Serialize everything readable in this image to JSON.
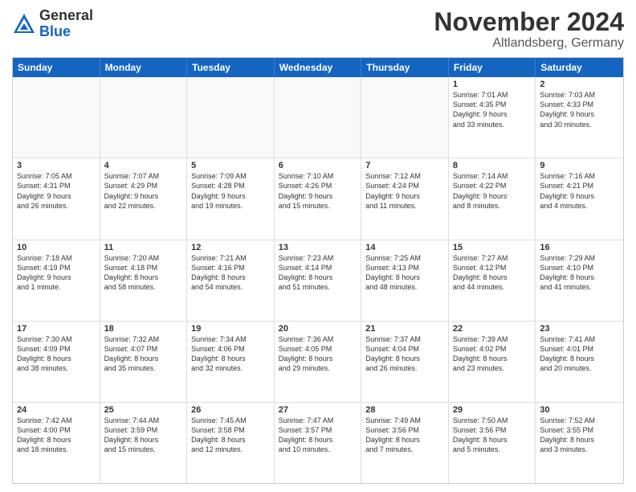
{
  "header": {
    "logo_general": "General",
    "logo_blue": "Blue",
    "month_title": "November 2024",
    "location": "Altlandsberg, Germany"
  },
  "days_of_week": [
    "Sunday",
    "Monday",
    "Tuesday",
    "Wednesday",
    "Thursday",
    "Friday",
    "Saturday"
  ],
  "rows": [
    [
      {
        "day": "",
        "info": ""
      },
      {
        "day": "",
        "info": ""
      },
      {
        "day": "",
        "info": ""
      },
      {
        "day": "",
        "info": ""
      },
      {
        "day": "",
        "info": ""
      },
      {
        "day": "1",
        "info": "Sunrise: 7:01 AM\nSunset: 4:35 PM\nDaylight: 9 hours\nand 33 minutes."
      },
      {
        "day": "2",
        "info": "Sunrise: 7:03 AM\nSunset: 4:33 PM\nDaylight: 9 hours\nand 30 minutes."
      }
    ],
    [
      {
        "day": "3",
        "info": "Sunrise: 7:05 AM\nSunset: 4:31 PM\nDaylight: 9 hours\nand 26 minutes."
      },
      {
        "day": "4",
        "info": "Sunrise: 7:07 AM\nSunset: 4:29 PM\nDaylight: 9 hours\nand 22 minutes."
      },
      {
        "day": "5",
        "info": "Sunrise: 7:09 AM\nSunset: 4:28 PM\nDaylight: 9 hours\nand 19 minutes."
      },
      {
        "day": "6",
        "info": "Sunrise: 7:10 AM\nSunset: 4:26 PM\nDaylight: 9 hours\nand 15 minutes."
      },
      {
        "day": "7",
        "info": "Sunrise: 7:12 AM\nSunset: 4:24 PM\nDaylight: 9 hours\nand 11 minutes."
      },
      {
        "day": "8",
        "info": "Sunrise: 7:14 AM\nSunset: 4:22 PM\nDaylight: 9 hours\nand 8 minutes."
      },
      {
        "day": "9",
        "info": "Sunrise: 7:16 AM\nSunset: 4:21 PM\nDaylight: 9 hours\nand 4 minutes."
      }
    ],
    [
      {
        "day": "10",
        "info": "Sunrise: 7:18 AM\nSunset: 4:19 PM\nDaylight: 9 hours\nand 1 minute."
      },
      {
        "day": "11",
        "info": "Sunrise: 7:20 AM\nSunset: 4:18 PM\nDaylight: 8 hours\nand 58 minutes."
      },
      {
        "day": "12",
        "info": "Sunrise: 7:21 AM\nSunset: 4:16 PM\nDaylight: 8 hours\nand 54 minutes."
      },
      {
        "day": "13",
        "info": "Sunrise: 7:23 AM\nSunset: 4:14 PM\nDaylight: 8 hours\nand 51 minutes."
      },
      {
        "day": "14",
        "info": "Sunrise: 7:25 AM\nSunset: 4:13 PM\nDaylight: 8 hours\nand 48 minutes."
      },
      {
        "day": "15",
        "info": "Sunrise: 7:27 AM\nSunset: 4:12 PM\nDaylight: 8 hours\nand 44 minutes."
      },
      {
        "day": "16",
        "info": "Sunrise: 7:29 AM\nSunset: 4:10 PM\nDaylight: 8 hours\nand 41 minutes."
      }
    ],
    [
      {
        "day": "17",
        "info": "Sunrise: 7:30 AM\nSunset: 4:09 PM\nDaylight: 8 hours\nand 38 minutes."
      },
      {
        "day": "18",
        "info": "Sunrise: 7:32 AM\nSunset: 4:07 PM\nDaylight: 8 hours\nand 35 minutes."
      },
      {
        "day": "19",
        "info": "Sunrise: 7:34 AM\nSunset: 4:06 PM\nDaylight: 8 hours\nand 32 minutes."
      },
      {
        "day": "20",
        "info": "Sunrise: 7:36 AM\nSunset: 4:05 PM\nDaylight: 8 hours\nand 29 minutes."
      },
      {
        "day": "21",
        "info": "Sunrise: 7:37 AM\nSunset: 4:04 PM\nDaylight: 8 hours\nand 26 minutes."
      },
      {
        "day": "22",
        "info": "Sunrise: 7:39 AM\nSunset: 4:02 PM\nDaylight: 8 hours\nand 23 minutes."
      },
      {
        "day": "23",
        "info": "Sunrise: 7:41 AM\nSunset: 4:01 PM\nDaylight: 8 hours\nand 20 minutes."
      }
    ],
    [
      {
        "day": "24",
        "info": "Sunrise: 7:42 AM\nSunset: 4:00 PM\nDaylight: 8 hours\nand 18 minutes."
      },
      {
        "day": "25",
        "info": "Sunrise: 7:44 AM\nSunset: 3:59 PM\nDaylight: 8 hours\nand 15 minutes."
      },
      {
        "day": "26",
        "info": "Sunrise: 7:45 AM\nSunset: 3:58 PM\nDaylight: 8 hours\nand 12 minutes."
      },
      {
        "day": "27",
        "info": "Sunrise: 7:47 AM\nSunset: 3:57 PM\nDaylight: 8 hours\nand 10 minutes."
      },
      {
        "day": "28",
        "info": "Sunrise: 7:49 AM\nSunset: 3:56 PM\nDaylight: 8 hours\nand 7 minutes."
      },
      {
        "day": "29",
        "info": "Sunrise: 7:50 AM\nSunset: 3:56 PM\nDaylight: 8 hours\nand 5 minutes."
      },
      {
        "day": "30",
        "info": "Sunrise: 7:52 AM\nSunset: 3:55 PM\nDaylight: 8 hours\nand 3 minutes."
      }
    ]
  ]
}
